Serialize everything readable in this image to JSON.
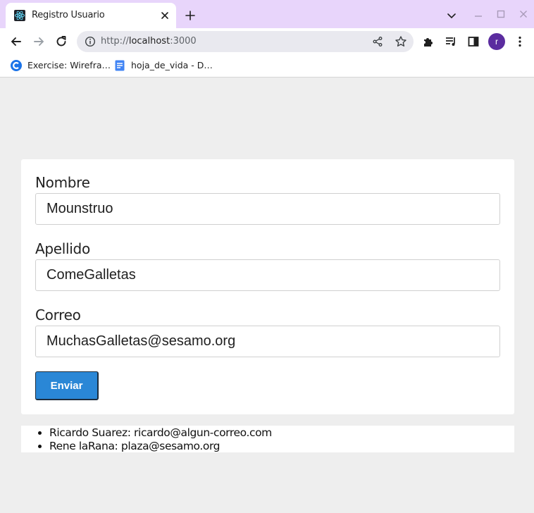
{
  "browser": {
    "tab_title": "Registro Usuario",
    "url_scheme": "http://",
    "url_host": "localhost",
    "url_port": ":3000",
    "avatar_letter": "r",
    "bookmarks": [
      {
        "label": "Exercise: Wirefra…",
        "icon": "chrome-c-icon"
      },
      {
        "label": "hoja_de_vida - D…",
        "icon": "google-docs-icon"
      }
    ],
    "colors": {
      "tabstrip": "#e8d5fb",
      "avatar": "#5b2c9f"
    }
  },
  "form": {
    "nombre_label": "Nombre",
    "nombre_value": "Mounstruo",
    "apellido_label": "Apellido",
    "apellido_value": "ComeGalletas",
    "correo_label": "Correo",
    "correo_value": "MuchasGalletas@sesamo.org",
    "submit_label": "Enviar",
    "submit_color": "#2a87d6"
  },
  "users": [
    "Ricardo Suarez: ricardo@algun-correo.com",
    "Rene laRana: plaza@sesamo.org"
  ]
}
